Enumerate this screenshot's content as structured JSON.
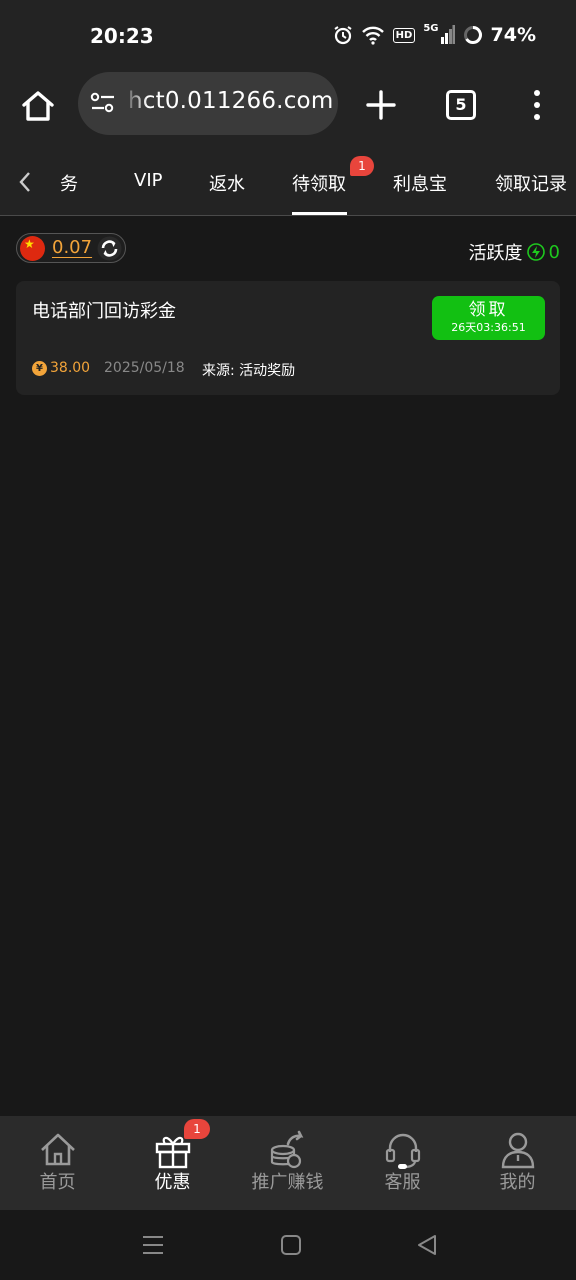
{
  "status_bar": {
    "time": "20:23",
    "network": "5G",
    "hd": "HD",
    "battery": "74%"
  },
  "browser": {
    "url": "hct0.011266.com",
    "tab_count": "5"
  },
  "tabs": {
    "items": [
      "任务",
      "VIP",
      "返水",
      "待领取",
      "利息宝",
      "领取记录"
    ],
    "active": "待领取",
    "pending_badge": "1"
  },
  "balance": {
    "value": "0.07",
    "activity_label": "活跃度",
    "activity_value": "0"
  },
  "reward": {
    "title": "电话部门回访彩金",
    "claim_label": "领取",
    "countdown": "26天03:36:51",
    "currency_symbol": "¥",
    "amount": "38.00",
    "date": "2025/05/18",
    "source": "来源: 活动奖励"
  },
  "bottom_nav": {
    "items": [
      "首页",
      "优惠",
      "推广赚钱",
      "客服",
      "我的"
    ],
    "active": "优惠",
    "promo_badge": "1"
  },
  "colors": {
    "accent_orange": "#f2a43a",
    "claim_green": "#12c012",
    "badge_red": "#e8453c",
    "background": "#181818"
  }
}
